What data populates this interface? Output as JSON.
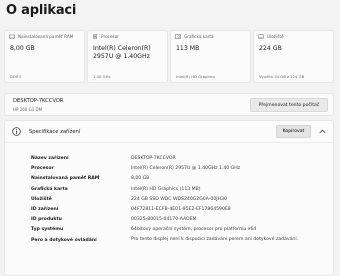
{
  "page": {
    "title": "O aplikaci"
  },
  "cards": [
    {
      "icon": "memory-icon",
      "label": "Nainstalovaná paměť RAM",
      "value": "8,00 GB",
      "sub": "DDR3"
    },
    {
      "icon": "processor-icon",
      "label": "Procesor",
      "value": "Intel(R) Celeron(R) 2957U @ 1.40GHz",
      "sub": "1.40 GHz"
    },
    {
      "icon": "graphics-card-icon",
      "label": "Grafická karta",
      "value": "113 MB",
      "sub": "Intel(R) HD Graphics"
    },
    {
      "icon": "storage-icon",
      "label": "Úložiště",
      "value": "224 GB",
      "sub": "Využito 34 GB z 224 GB"
    }
  ],
  "device": {
    "name": "DESKTOP-7KCCVOR",
    "model": "HP 260 G1 DM",
    "rename_label": "Přejmenovat tento počítač"
  },
  "spec": {
    "title": "Specifikace zařízení",
    "copy_label": "Kopírovat",
    "rows": [
      {
        "key": "Název zařízení",
        "value": "DESKTOP-7KCCVOR"
      },
      {
        "key": "Procesor",
        "value": "Intel(R) Celeron(R) 2957U @ 1.40GHz   1.40 GHz"
      },
      {
        "key": "Nainstalovaná paměť RAM",
        "value": "8,00 GB"
      },
      {
        "key": "Grafická karta",
        "value": "Intel(R) HD Graphics (113 MB)"
      },
      {
        "key": "Úložiště",
        "value": "224 GB SSD WDC WDS240G2G0A-00JH30"
      },
      {
        "key": "ID zařízení",
        "value": "04F72811-ECFB-4E01-95E2-EF17864590E8"
      },
      {
        "key": "ID produktu",
        "value": "00325-80015-04170-AAOEM"
      },
      {
        "key": "Typ systému",
        "value": "64bitový operační systém, procesor pro platformu x64"
      },
      {
        "key": "Pero a dotykové ovládání",
        "value": "Pro tento displej není k dispozici zadávání perem ani dotykové zadávání."
      }
    ]
  }
}
